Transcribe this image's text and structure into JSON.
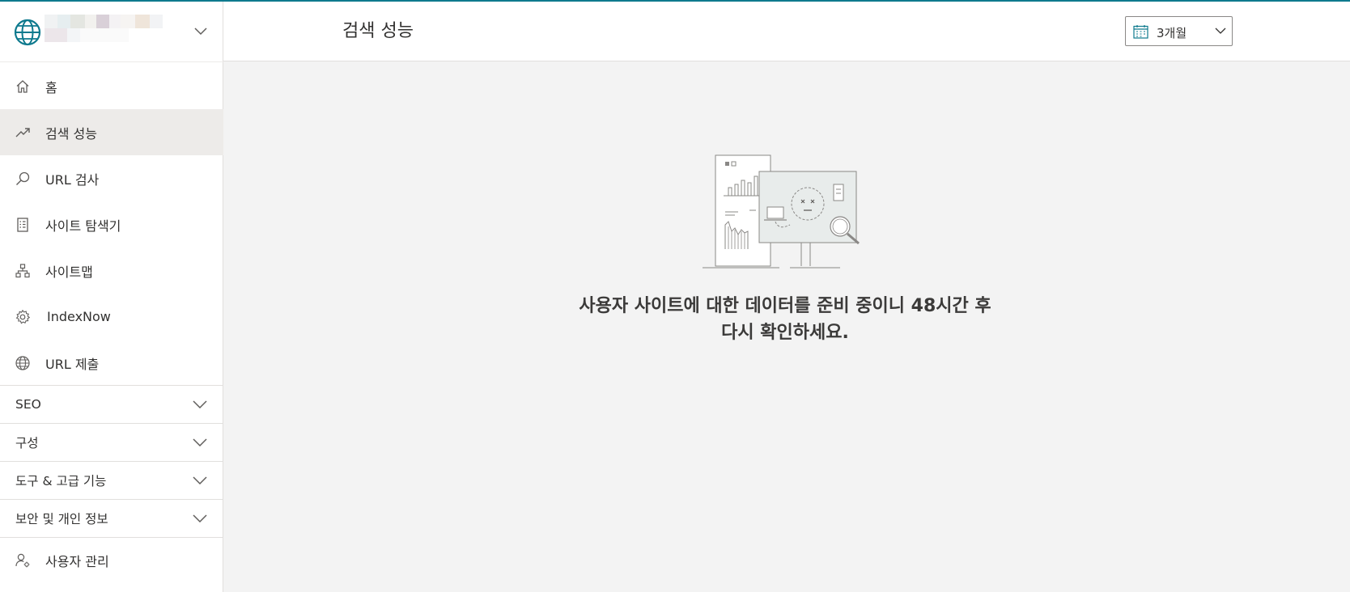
{
  "sidebar": {
    "site_icon": "globe-icon",
    "nav": [
      {
        "label": "홈",
        "icon": "home-icon"
      },
      {
        "label": "검색 성능",
        "icon": "trending-up-icon",
        "active": true
      },
      {
        "label": "URL 검사",
        "icon": "search-icon"
      },
      {
        "label": "사이트 탐색기",
        "icon": "document-list-icon"
      },
      {
        "label": "사이트맵",
        "icon": "sitemap-icon"
      },
      {
        "label": "IndexNow",
        "icon": "gear-icon"
      },
      {
        "label": "URL 제출",
        "icon": "globe-icon"
      }
    ],
    "groups": [
      {
        "label": "SEO"
      },
      {
        "label": "구성"
      },
      {
        "label": "도구 & 고급 기능"
      },
      {
        "label": "보안 및 개인 정보"
      }
    ],
    "bottom": {
      "label": "사용자 관리",
      "icon": "user-settings-icon"
    }
  },
  "header": {
    "title": "검색 성능",
    "range": {
      "label": "3개월",
      "icon": "calendar-icon"
    }
  },
  "main": {
    "empty_message_line1": "사용자 사이트에 대한 데이터를 준비 중이니 48시간 후",
    "empty_message_line2": "다시 확인하세요."
  },
  "colors": {
    "accent": "#0e7a8e",
    "active_nav": "#edebe9",
    "content_bg": "#f3f3f3"
  }
}
